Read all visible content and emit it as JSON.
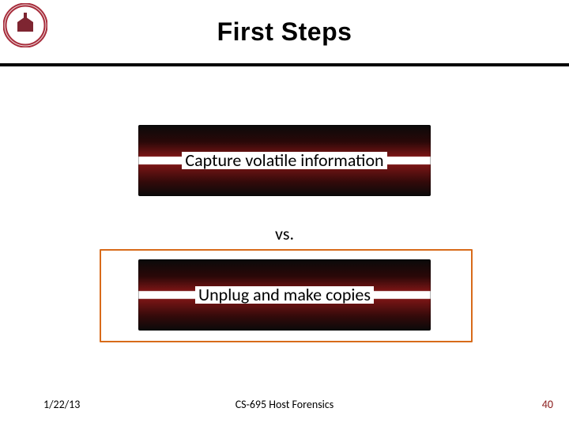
{
  "header": {
    "title": "First Steps",
    "logo_colors": {
      "ring": "#a72c3b",
      "inner": "#7e2531"
    }
  },
  "content": {
    "top_box": "Capture volatile information",
    "vs": "vs.",
    "bottom_box": "Unplug and make copies"
  },
  "footer": {
    "date": "1/22/13",
    "course": "CS-695 Host Forensics",
    "page": "40"
  },
  "colors": {
    "rule": "#000000",
    "highlight": "#d86b1a",
    "page_number": "#8a1b1b"
  }
}
